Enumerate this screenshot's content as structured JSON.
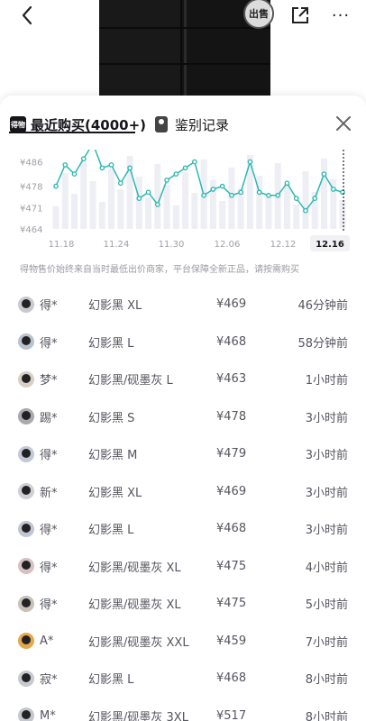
{
  "header": {
    "back_glyph": "‹",
    "sell_label": "出售",
    "more_glyph": "···"
  },
  "tabs": [
    {
      "logo": "得物",
      "label": "最近购买(4000+)",
      "active": true
    },
    {
      "label": "鉴别记录",
      "active": false
    }
  ],
  "chart_data": {
    "type": "line",
    "ylabels": [
      "¥486",
      "¥478",
      "¥471",
      "¥464"
    ],
    "ylim": [
      464,
      490
    ],
    "x_ticks": [
      "11.18",
      "11.24",
      "11.30",
      "12.06",
      "12.12",
      "12.16"
    ],
    "highlighted_tick": "12.16",
    "series": [
      {
        "values": [
          478,
          485,
          482,
          487,
          492,
          484,
          485,
          479,
          484,
          474,
          476,
          472,
          480,
          482,
          484,
          486,
          475,
          477,
          478,
          475,
          476,
          486,
          476,
          475,
          475,
          479,
          474,
          470,
          474,
          482,
          477,
          476
        ]
      }
    ],
    "line_color": "#2bb8b0",
    "bar_color": "#eeeef5"
  },
  "note": "得物售价始终来自当时最低出价商家，平台保障全新正品，请按需购买",
  "purchases": [
    {
      "user": "得*",
      "size": "幻影黑 XL",
      "price": "¥469",
      "time": "46分钟前"
    },
    {
      "user": "得*",
      "size": "幻影黑 L",
      "price": "¥468",
      "time": "58分钟前"
    },
    {
      "user": "梦*",
      "size": "幻影黑/砚墨灰 L",
      "price": "¥463",
      "time": "1小时前"
    },
    {
      "user": "踢*",
      "size": "幻影黑 S",
      "price": "¥478",
      "time": "3小时前"
    },
    {
      "user": "得*",
      "size": "幻影黑 M",
      "price": "¥479",
      "time": "3小时前"
    },
    {
      "user": "新*",
      "size": "幻影黑 XL",
      "price": "¥469",
      "time": "3小时前"
    },
    {
      "user": "得*",
      "size": "幻影黑 L",
      "price": "¥468",
      "time": "3小时前"
    },
    {
      "user": "得*",
      "size": "幻影黑/砚墨灰 XL",
      "price": "¥475",
      "time": "4小时前"
    },
    {
      "user": "得*",
      "size": "幻影黑/砚墨灰 XL",
      "price": "¥475",
      "time": "5小时前"
    },
    {
      "user": "A*",
      "size": "幻影黑/砚墨灰 XXL",
      "price": "¥459",
      "time": "7小时前"
    },
    {
      "user": "寂*",
      "size": "幻影黑 L",
      "price": "¥468",
      "time": "8小时前"
    },
    {
      "user": "M*",
      "size": "幻影黑/砚墨灰 3XL",
      "price": "¥517",
      "time": "8小时前"
    }
  ]
}
